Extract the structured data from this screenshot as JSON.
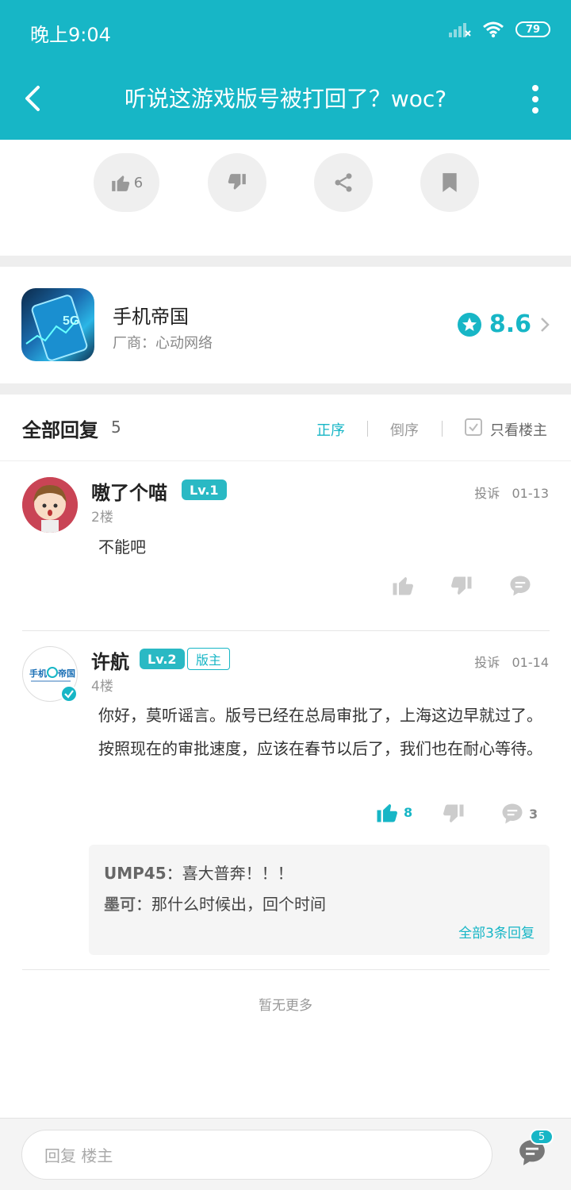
{
  "status": {
    "time": "晚上9:04",
    "battery": "79"
  },
  "header": {
    "title": "听说这游戏版号被打回了？woc?"
  },
  "post_actions": {
    "like_count": "6"
  },
  "game": {
    "name": "手机帝国",
    "vendor": "厂商：心动网络",
    "rating": "8.6"
  },
  "replies": {
    "title": "全部回复",
    "count": "5",
    "sort_asc": "正序",
    "sort_desc": "倒序",
    "only_op": "只看楼主",
    "items": [
      {
        "name": "嗷了个喵",
        "level": "Lv.1",
        "floor": "2楼",
        "report": "投诉",
        "date": "01-13",
        "text": "不能吧"
      },
      {
        "name": "许航",
        "level": "Lv.2",
        "badge": "版主",
        "floor": "4楼",
        "report": "投诉",
        "date": "01-14",
        "text": "你好，莫听谣言。版号已经在总局审批了，上海这边早就过了。按照现在的审批速度，应该在春节以后了，我们也在耐心等待。",
        "likes": "8",
        "comments": "3",
        "sub": [
          {
            "name": "UMP45",
            "sep": "：",
            "text": "喜大普奔！！！"
          },
          {
            "name": "墨可",
            "sep": "：",
            "text": "那什么时候出，回个时间"
          }
        ],
        "sub_all": "全部3条回复"
      }
    ],
    "no_more": "暂无更多"
  },
  "bottom": {
    "placeholder": "回复 楼主",
    "badge": "5"
  }
}
